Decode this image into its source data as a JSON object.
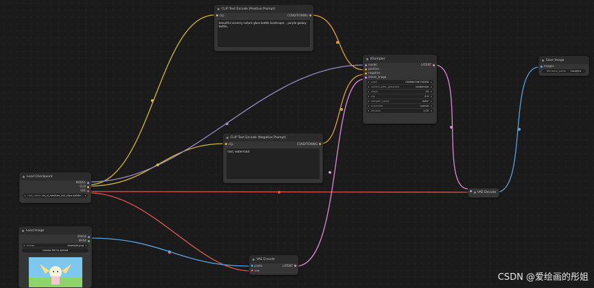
{
  "colors": {
    "clip": "#d8b933",
    "conditioning": "#e3a23a",
    "model": "#9b8fc9",
    "latent": "#e18ad9",
    "vae": "#e0574e",
    "image": "#5aa4e0",
    "mask": "#74b47a"
  },
  "nodes": {
    "positive": {
      "title": "CLIP Text Encode (Positive Prompt)",
      "in_clip": "clip",
      "out_conditioning": "CONDITIONING",
      "text": "beautiful scenery nature glass bottle landscape, , purple galaxy bottle,"
    },
    "negative": {
      "title": "CLIP Text Encode (Negative Prompt)",
      "in_clip": "clip",
      "out_conditioning": "CONDITIONING",
      "text": "text, watermark"
    },
    "ksampler": {
      "title": "KSampler",
      "in_model": "model",
      "in_positive": "positive",
      "in_negative": "negative",
      "in_latent": "latent_image",
      "out_latent": "LATENT",
      "widgets": [
        {
          "label": "seed",
          "value": "156680208700286"
        },
        {
          "label": "control_after_generate",
          "value": "randomize"
        },
        {
          "label": "steps",
          "value": "20"
        },
        {
          "label": "cfg",
          "value": "8.0"
        },
        {
          "label": "sampler_name",
          "value": "euler"
        },
        {
          "label": "scheduler",
          "value": "normal"
        },
        {
          "label": "denoise",
          "value": "1.00"
        }
      ]
    },
    "save": {
      "title": "Save Image",
      "in_images": "images",
      "widget_label": "filename_prefix",
      "widget_value": "ComfyUI"
    },
    "checkpoint": {
      "title": "Load Checkpoint",
      "out_model": "MODEL",
      "out_clip": "CLIP",
      "out_vae": "VAE",
      "widget_label": "ckpt_name",
      "widget_value": "sd_xl_medium_incl_clips.safete..."
    },
    "vae_decode": {
      "title": "VAE Decode"
    },
    "load_image": {
      "title": "Load Image",
      "out_image": "IMAGE",
      "out_mask": "MASK",
      "widget_label": "image",
      "widget_value": "example.png",
      "upload_label": "choose file to upload"
    },
    "vae_encode": {
      "title": "VAE Encode",
      "in_pixels": "pixels",
      "in_vae": "vae",
      "out_latent": "LATENT"
    }
  },
  "watermark": "CSDN @爱绘画的彤姐"
}
